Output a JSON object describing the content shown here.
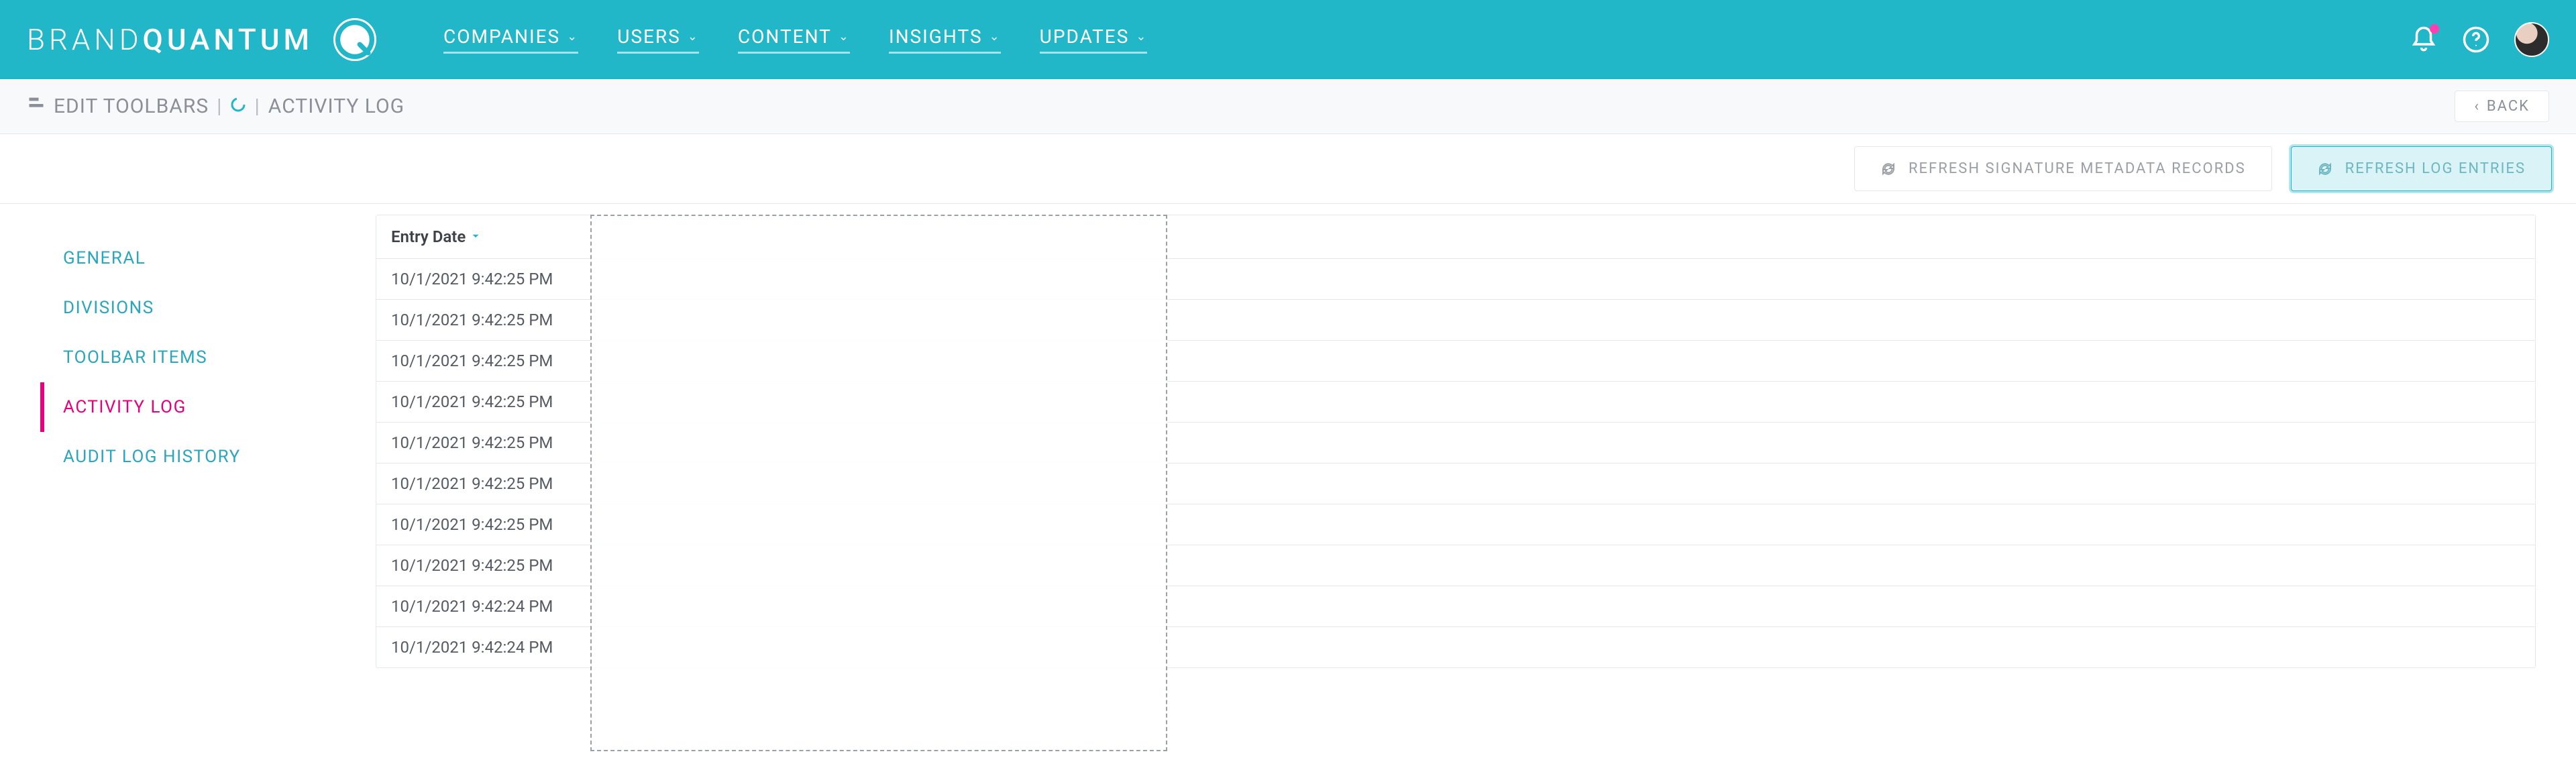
{
  "brand": {
    "word1": "BRAND",
    "word2": "QUANTUM"
  },
  "nav": {
    "items": [
      {
        "label": "COMPANIES"
      },
      {
        "label": "USERS"
      },
      {
        "label": "CONTENT"
      },
      {
        "label": "INSIGHTS"
      },
      {
        "label": "UPDATES"
      }
    ]
  },
  "subheader": {
    "title": "EDIT TOOLBARS",
    "section": "ACTIVITY LOG",
    "back": "BACK"
  },
  "actions": {
    "refresh_metadata": "REFRESH SIGNATURE METADATA RECORDS",
    "refresh_log": "REFRESH LOG ENTRIES"
  },
  "sidebar": {
    "items": [
      {
        "label": "GENERAL"
      },
      {
        "label": "DIVISIONS"
      },
      {
        "label": "TOOLBAR ITEMS"
      },
      {
        "label": "ACTIVITY LOG"
      },
      {
        "label": "AUDIT LOG HISTORY"
      }
    ],
    "active_index": 3
  },
  "table": {
    "header": {
      "entry_date": "Entry Date"
    },
    "rows": [
      {
        "date": "10/1/2021 9:42:25 PM"
      },
      {
        "date": "10/1/2021 9:42:25 PM"
      },
      {
        "date": "10/1/2021 9:42:25 PM"
      },
      {
        "date": "10/1/2021 9:42:25 PM"
      },
      {
        "date": "10/1/2021 9:42:25 PM"
      },
      {
        "date": "10/1/2021 9:42:25 PM"
      },
      {
        "date": "10/1/2021 9:42:25 PM"
      },
      {
        "date": "10/1/2021 9:42:25 PM"
      },
      {
        "date": "10/1/2021 9:42:24 PM"
      },
      {
        "date": "10/1/2021 9:42:24 PM"
      }
    ]
  }
}
